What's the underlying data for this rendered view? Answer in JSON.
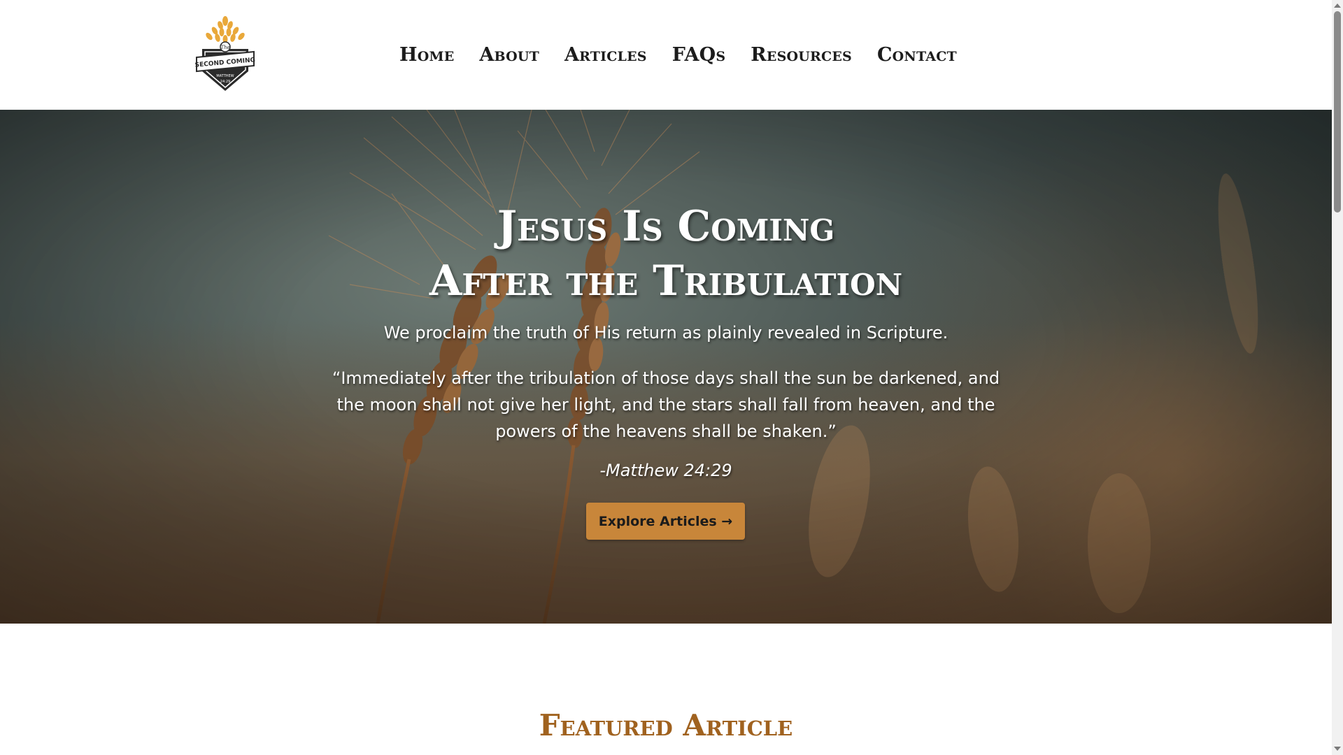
{
  "logo": {
    "name": "logo-icon",
    "text_top": "The",
    "text_main": "SECOND COMING",
    "text_small": "MATTHEW 24:29"
  },
  "nav": {
    "items": [
      {
        "label": "Home"
      },
      {
        "label": "About"
      },
      {
        "label": "Articles"
      },
      {
        "label": "FAQs"
      },
      {
        "label": "Resources"
      },
      {
        "label": "Contact"
      }
    ]
  },
  "hero": {
    "title_line1": "Jesus Is Coming",
    "title_line2": "After the Tribulation",
    "subtitle": "We proclaim the truth of His return as plainly revealed in Scripture.",
    "quote": "“Immediately after the tribulation of those days shall the sun be darkened, and the moon shall not give her light, and the stars shall fall from heaven, and the powers of the heavens shall be shaken.”",
    "reference": "-Matthew 24:29",
    "button_label": "Explore Articles →"
  },
  "featured": {
    "title": "Featured Article"
  },
  "colors": {
    "accent": "#c8863a",
    "heading_accent": "#a0621f",
    "nav_text": "#1c1c1c"
  },
  "icons": {
    "scroll_up": "chevron-up-icon",
    "scroll_down": "chevron-down-icon"
  }
}
